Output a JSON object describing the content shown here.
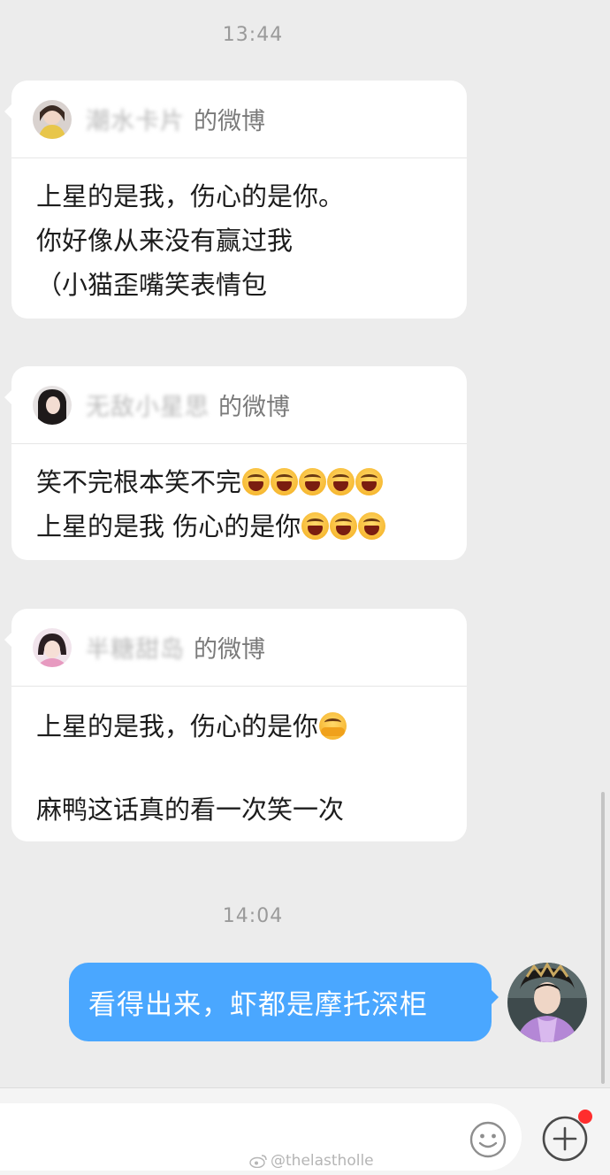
{
  "timestamps": [
    "13:44",
    "14:04"
  ],
  "cards": [
    {
      "author": "潮水卡片",
      "suffix": "的微博",
      "lines": [
        {
          "text": "上星的是我，伤心的是你。",
          "emoji_count": 0,
          "emoji": ""
        },
        {
          "text": "你好像从来没有赢过我",
          "emoji_count": 0,
          "emoji": ""
        },
        {
          "text": "（小猫歪嘴笑表情包",
          "emoji_count": 0,
          "emoji": ""
        }
      ]
    },
    {
      "author": "无敌小星思",
      "suffix": "的微博",
      "lines": [
        {
          "text": "笑不完根本笑不完",
          "emoji_count": 5,
          "emoji": "laughing-face"
        },
        {
          "text": "上星的是我 伤心的是你",
          "emoji_count": 3,
          "emoji": "laughing-face"
        }
      ]
    },
    {
      "author": "半糖甜岛",
      "suffix": "的微博",
      "lines": [
        {
          "text": "上星的是我，伤心的是你",
          "emoji_count": 1,
          "emoji": "hugging-face"
        },
        {
          "text": "",
          "emoji_count": 0,
          "emoji": ""
        },
        {
          "text": "麻鸭这话真的看一次笑一次",
          "emoji_count": 0,
          "emoji": ""
        }
      ]
    }
  ],
  "outgoing": {
    "text": "看得出来，虾都是摩托深柜"
  },
  "input_bar": {
    "placeholder": "",
    "emoji_icon": "smiley-icon",
    "plus_icon": "plus-circle-icon",
    "notification": "red-dot"
  },
  "watermark": "@thelastholle",
  "colors": {
    "outgoing_bubble": "#4aa7ff",
    "background": "#ececec",
    "notification_dot": "#ff2d2d"
  }
}
